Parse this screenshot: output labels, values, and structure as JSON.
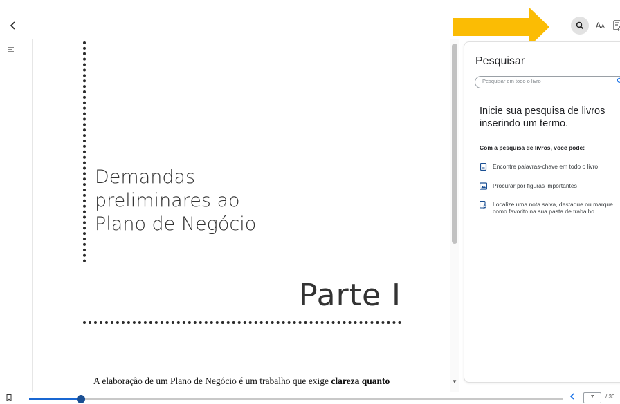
{
  "toolbar": {
    "back_icon": "chevron-left-icon",
    "font_label": "A",
    "font_label_small": "A",
    "icons": [
      "search-icon",
      "font-size-icon",
      "notebook-icon"
    ],
    "accent_color": "#1a73e8",
    "arrow_color": "#FBBC04"
  },
  "page": {
    "chapter_title": "Demandas\npreliminares ao\nPlano de Negócio",
    "part_label": "Parte I",
    "body_start": "A elaboração de um Plano de Negócio é um trabalho que exige ",
    "body_bold": "clareza quanto"
  },
  "search_panel": {
    "title": "Pesquisar",
    "placeholder": "Pesquisar em todo o livro",
    "intro": "Inicie sua pesquisa de livros inserindo um termo.",
    "subhead": "Com a pesquisa de livros, você pode:",
    "features": [
      {
        "icon": "document-icon",
        "text": "Encontre palavras-chave em todo o livro"
      },
      {
        "icon": "image-icon",
        "text": "Procurar por figuras importantes"
      },
      {
        "icon": "notebook-star-icon",
        "text": "Localize uma nota salva, destaque ou marque como favorito na sua pasta de trabalho"
      }
    ]
  },
  "footer": {
    "progress": 0.097,
    "current_page": "7",
    "total_pages": "/ 30"
  }
}
